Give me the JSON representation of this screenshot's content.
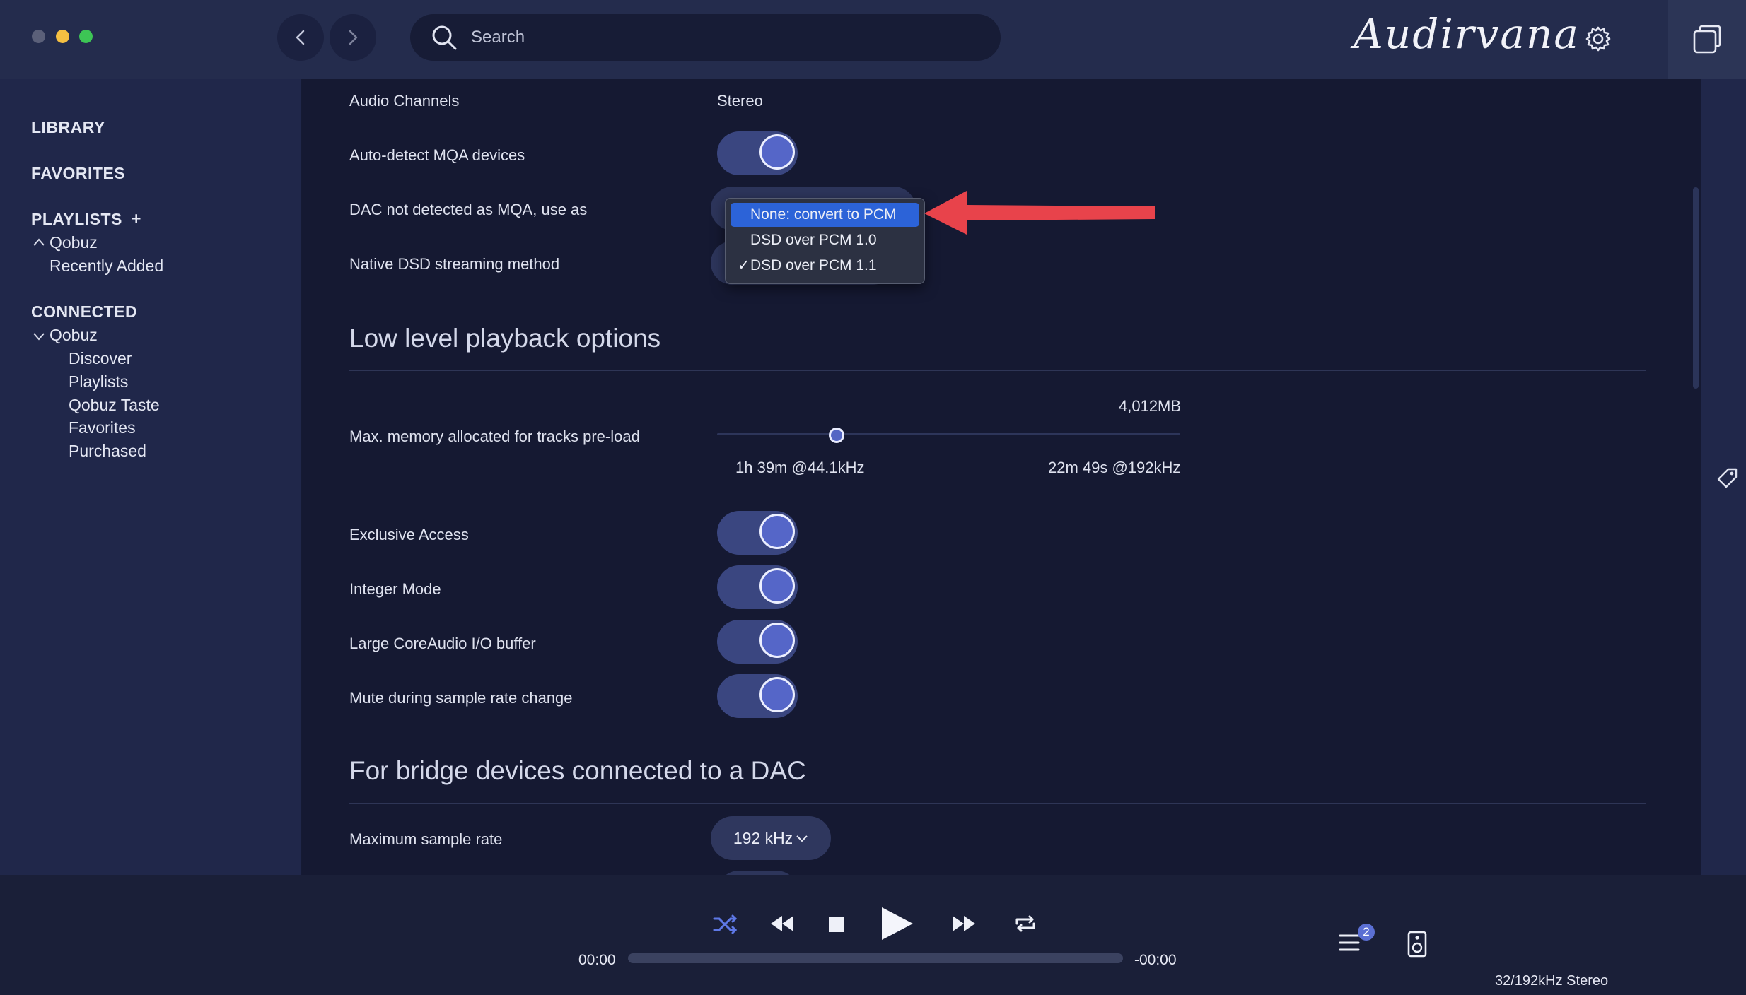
{
  "app": {
    "logo_text": "Audirvana",
    "search_placeholder": "Search"
  },
  "sidebar": {
    "library": "LIBRARY",
    "favorites": "FAVORITES",
    "playlists": "PLAYLISTS",
    "playlists_add": "+",
    "playlists_group": "Qobuz",
    "playlists_group_chevron": "^",
    "playlists_recent": "Recently Added",
    "connected": "CONNECTED",
    "connected_group": "Qobuz",
    "connected_group_chevron": "v",
    "connected_items": [
      "Discover",
      "Playlists",
      "Qobuz Taste",
      "Favorites",
      "Purchased"
    ]
  },
  "settings": {
    "audio_channels_label": "Audio Channels",
    "audio_channels_value": "Stereo",
    "mqa_autodetect_label": "Auto-detect MQA devices",
    "mqa_autodetect_on": true,
    "dac_not_mqa_label": "DAC not detected as MQA, use as",
    "native_dsd_label": "Native DSD streaming method",
    "low_level_title": "Low level playback options",
    "memory_label": "Max. memory allocated for tracks pre-load",
    "memory_value": "4,012MB",
    "memory_left_hint": "1h 39m @44.1kHz",
    "memory_right_hint": "22m 49s @192kHz",
    "memory_fraction": 0.25,
    "exclusive_label": "Exclusive Access",
    "integer_label": "Integer Mode",
    "coreaudio_label": "Large CoreAudio I/O buffer",
    "mute_label": "Mute during sample rate change",
    "bridge_title": "For bridge devices connected to a DAC",
    "max_sample_rate_label": "Maximum sample rate",
    "max_sample_rate_value": "192 kHz"
  },
  "menu": {
    "options": [
      "None: convert to PCM",
      "DSD over PCM 1.0",
      "DSD over PCM 1.1"
    ],
    "highlighted": "None: convert to PCM",
    "checked": "DSD over PCM 1.1",
    "check_glyph": "✓"
  },
  "player": {
    "elapsed": "00:00",
    "remaining": "-00:00",
    "queue_count": "2",
    "format": "32/192kHz Stereo"
  },
  "colors": {
    "accent": "#5566c8",
    "arrow": "#e8434b",
    "menu_highlight": "#2c63d8"
  }
}
